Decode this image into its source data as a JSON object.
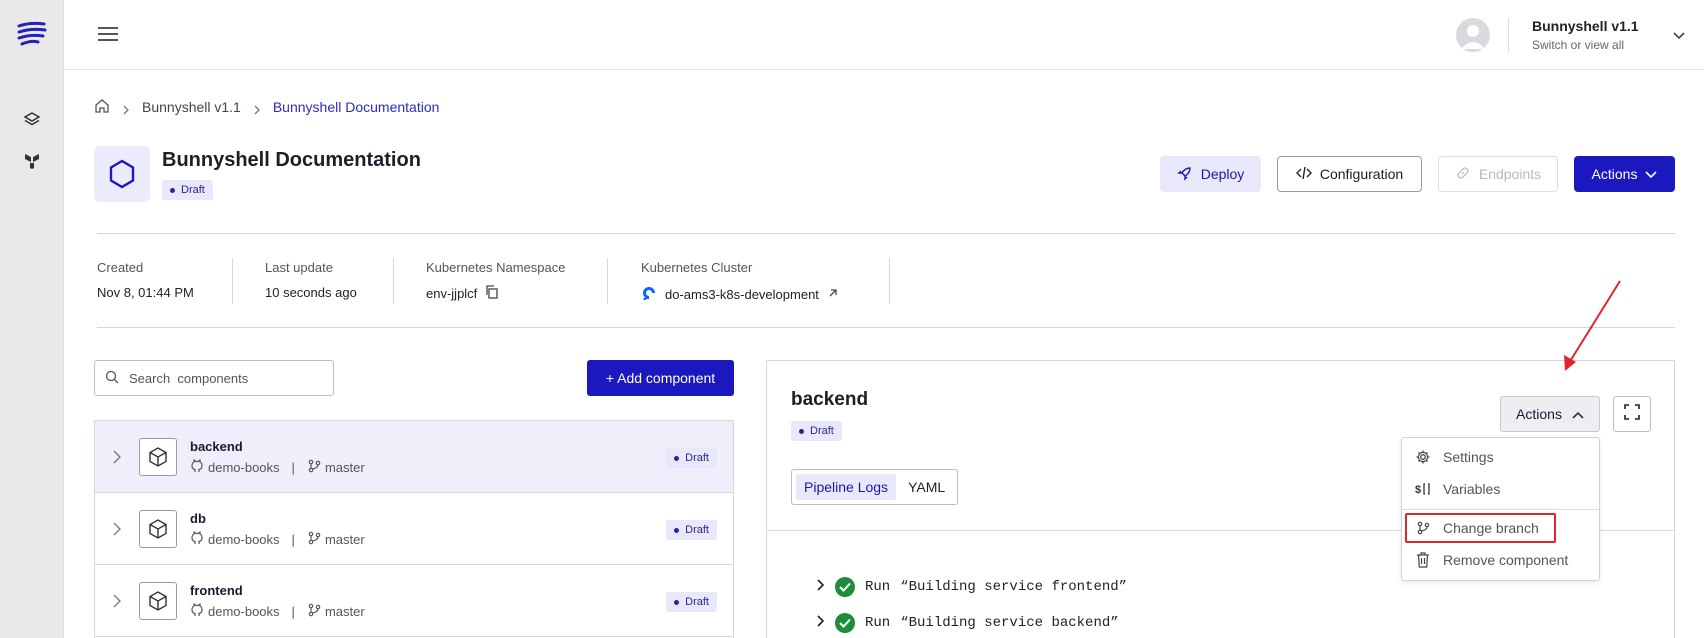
{
  "sidebar": {
    "icons": [
      "bunnyshell-logo",
      "layers-icon",
      "terraform-icon"
    ]
  },
  "topbar": {
    "user_name": "Bunnyshell v1.1",
    "user_sub": "Switch or view all"
  },
  "breadcrumb": {
    "items": [
      "Bunnyshell v1.1",
      "Bunnyshell Documentation"
    ]
  },
  "environment": {
    "title": "Bunnyshell Documentation",
    "status": "Draft",
    "buttons": {
      "deploy": "Deploy",
      "configuration": "Configuration",
      "endpoints": "Endpoints",
      "actions": "Actions"
    },
    "meta": {
      "created_label": "Created",
      "created_value": "Nov 8, 01:44 PM",
      "updated_label": "Last update",
      "updated_value": "10 seconds ago",
      "namespace_label": "Kubernetes Namespace",
      "namespace_value": "env-jjplcf",
      "cluster_label": "Kubernetes Cluster",
      "cluster_value": "do-ams3-k8s-development"
    }
  },
  "components": {
    "search_placeholder": "Search  components",
    "add_label": "+ Add component",
    "items": [
      {
        "name": "backend",
        "repo": "demo-books",
        "branch": "master",
        "status": "Draft"
      },
      {
        "name": "db",
        "repo": "demo-books",
        "branch": "master",
        "status": "Draft"
      },
      {
        "name": "frontend",
        "repo": "demo-books",
        "branch": "master",
        "status": "Draft"
      }
    ]
  },
  "detail": {
    "title": "backend",
    "status": "Draft",
    "actions_label": "Actions",
    "tabs": [
      "Pipeline Logs",
      "YAML"
    ],
    "logs": [
      {
        "keyword": "Run",
        "text": "“Building service frontend”"
      },
      {
        "keyword": "Run",
        "text": "“Building service backend”"
      }
    ],
    "menu": {
      "settings": "Settings",
      "variables": "Variables",
      "change_branch": "Change branch",
      "remove_component": "Remove component"
    }
  },
  "colors": {
    "accent": "#1b18c0",
    "badge_bg": "#e9e8fb",
    "annotation": "#e0252f",
    "success": "#1e8c3b"
  }
}
